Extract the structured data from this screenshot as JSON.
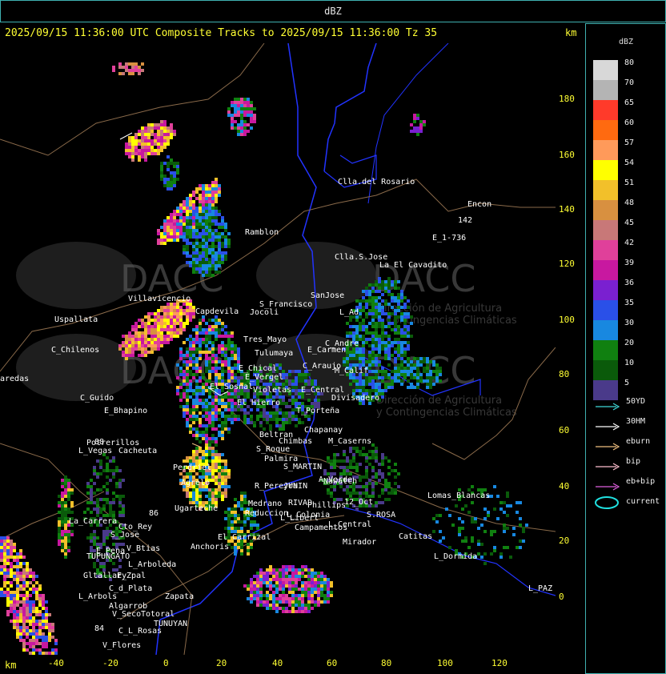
{
  "header": {
    "unit_title": "dBZ"
  },
  "title": "2025/09/15 11:36:00 UTC Composite Tracks to 2025/09/15 11:36:00 Tz 35",
  "axis": {
    "unit": "km",
    "y_ticks": [
      "180",
      "160",
      "140",
      "120",
      "100",
      "80",
      "60",
      "40",
      "20",
      "0"
    ],
    "x_ticks": [
      "-40",
      "-20",
      "0",
      "20",
      "40",
      "60",
      "80",
      "100",
      "120"
    ]
  },
  "legend": {
    "title": "dBZ",
    "scale": [
      {
        "label": "80",
        "color": "#d8d8d8"
      },
      {
        "label": "70",
        "color": "#b4b4b4"
      },
      {
        "label": "65",
        "color": "#ff3a2a"
      },
      {
        "label": "60",
        "color": "#ff6a10"
      },
      {
        "label": "57",
        "color": "#ff9a5a"
      },
      {
        "label": "54",
        "color": "#ffff00"
      },
      {
        "label": "51",
        "color": "#f2c02a"
      },
      {
        "label": "48",
        "color": "#d89040"
      },
      {
        "label": "45",
        "color": "#c87878"
      },
      {
        "label": "42",
        "color": "#e0409a"
      },
      {
        "label": "39",
        "color": "#c818a0"
      },
      {
        "label": "36",
        "color": "#7a20d0"
      },
      {
        "label": "35",
        "color": "#2a50e8"
      },
      {
        "label": "30",
        "color": "#1888e0"
      },
      {
        "label": "20",
        "color": "#108010"
      },
      {
        "label": "10",
        "color": "#0a5a0a"
      },
      {
        "label": "5",
        "color": "#4a3a8a"
      }
    ],
    "tracks": [
      {
        "label": "50YD",
        "color": "#40d8d8"
      },
      {
        "label": "30HM",
        "color": "#ffffff"
      },
      {
        "label": "eburn",
        "color": "#f0c080"
      },
      {
        "label": "bip",
        "color": "#ffc0d0"
      },
      {
        "label": "eb+bip",
        "color": "#e060e0"
      },
      {
        "label": "current",
        "color": "#20e0e0"
      }
    ]
  },
  "watermark": {
    "brand": "DACC",
    "line1": "Dirección de Agricultura",
    "line2": "y Contingencias Climáticas"
  },
  "places": [
    {
      "name": "Clla.del Rosario"
    },
    {
      "name": "Encon"
    },
    {
      "name": "142"
    },
    {
      "name": "E_1-736"
    },
    {
      "name": "Ramblon"
    },
    {
      "name": "Clla.S.Jose"
    },
    {
      "name": "La El Cavadito"
    },
    {
      "name": "S_Francisco"
    },
    {
      "name": "SanJose"
    },
    {
      "name": "Jocoli"
    },
    {
      "name": "L_Ad"
    },
    {
      "name": "Uspallata"
    },
    {
      "name": "Villavicencio"
    },
    {
      "name": "Capdevila"
    },
    {
      "name": "Tres_Mayo"
    },
    {
      "name": "C_Andre"
    },
    {
      "name": "E_Carmen"
    },
    {
      "name": "C_Chilenos"
    },
    {
      "name": "Tulumaya"
    },
    {
      "name": "C_Araujo"
    },
    {
      "name": "M_Calif"
    },
    {
      "name": "E_Chical"
    },
    {
      "name": "E_Vergel"
    },
    {
      "name": "aredas"
    },
    {
      "name": "El Sosnal"
    },
    {
      "name": "Violetas"
    },
    {
      "name": "E_Central"
    },
    {
      "name": "Divisadero"
    },
    {
      "name": "C_Guido"
    },
    {
      "name": "El Hierro"
    },
    {
      "name": "E_Bhapino"
    },
    {
      "name": "T_Porteña"
    },
    {
      "name": "Chapanay"
    },
    {
      "name": "Beltran"
    },
    {
      "name": "Chimbas"
    },
    {
      "name": "M_Caserns"
    },
    {
      "name": "Potrerillos"
    },
    {
      "name": "L_Vegas"
    },
    {
      "name": "Cacheuta"
    },
    {
      "name": "S_Roque"
    },
    {
      "name": "Palmira"
    },
    {
      "name": "S_MARTIN"
    },
    {
      "name": "Perdriel"
    },
    {
      "name": "A_Verde"
    },
    {
      "name": "R_Pereyra"
    },
    {
      "name": "JUNIN"
    },
    {
      "name": "Nawatch"
    },
    {
      "name": "Agrelo"
    },
    {
      "name": "Ugarteche"
    },
    {
      "name": "Medrano"
    },
    {
      "name": "RIVAD"
    },
    {
      "name": "Phillips"
    },
    {
      "name": "L_Colonia"
    },
    {
      "name": "12_Oct"
    },
    {
      "name": "S.ROSA"
    },
    {
      "name": "Lomas_Blancas"
    },
    {
      "name": "La_Carrera"
    },
    {
      "name": "Cto_Rey"
    },
    {
      "name": "S_Jose"
    },
    {
      "name": "Reduccion"
    },
    {
      "name": "L_Libert"
    },
    {
      "name": "L_Central"
    },
    {
      "name": "Campamentos"
    },
    {
      "name": "Catitas"
    },
    {
      "name": "El Carrizal"
    },
    {
      "name": "Mirador"
    },
    {
      "name": "E_Pena"
    },
    {
      "name": "V_Btias"
    },
    {
      "name": "Anchoris"
    },
    {
      "name": "TUPUNGATO"
    },
    {
      "name": "L_Arboleda"
    },
    {
      "name": "L_Dormida"
    },
    {
      "name": "Gltallary"
    },
    {
      "name": "E_Zpal"
    },
    {
      "name": "C_d_Plata"
    },
    {
      "name": "L_Arbols"
    },
    {
      "name": "Zapata"
    },
    {
      "name": "L_PAZ"
    },
    {
      "name": "Algarrob"
    },
    {
      "name": "V_Seco"
    },
    {
      "name": "Totoral"
    },
    {
      "name": "TUNUYAN"
    },
    {
      "name": "C_L_Rosas"
    },
    {
      "name": "V_Flores"
    },
    {
      "name": "88"
    },
    {
      "name": "86"
    },
    {
      "name": "84"
    }
  ]
}
